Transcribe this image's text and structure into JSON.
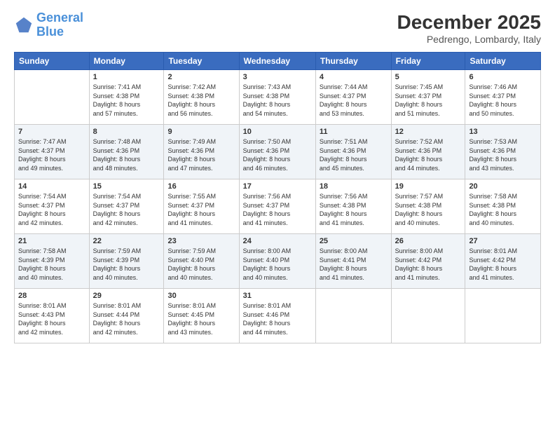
{
  "header": {
    "logo_line1": "General",
    "logo_line2": "Blue",
    "month_title": "December 2025",
    "location": "Pedrengo, Lombardy, Italy"
  },
  "days_of_week": [
    "Sunday",
    "Monday",
    "Tuesday",
    "Wednesday",
    "Thursday",
    "Friday",
    "Saturday"
  ],
  "weeks": [
    [
      {
        "num": "",
        "info": ""
      },
      {
        "num": "1",
        "info": "Sunrise: 7:41 AM\nSunset: 4:38 PM\nDaylight: 8 hours\nand 57 minutes."
      },
      {
        "num": "2",
        "info": "Sunrise: 7:42 AM\nSunset: 4:38 PM\nDaylight: 8 hours\nand 56 minutes."
      },
      {
        "num": "3",
        "info": "Sunrise: 7:43 AM\nSunset: 4:38 PM\nDaylight: 8 hours\nand 54 minutes."
      },
      {
        "num": "4",
        "info": "Sunrise: 7:44 AM\nSunset: 4:37 PM\nDaylight: 8 hours\nand 53 minutes."
      },
      {
        "num": "5",
        "info": "Sunrise: 7:45 AM\nSunset: 4:37 PM\nDaylight: 8 hours\nand 51 minutes."
      },
      {
        "num": "6",
        "info": "Sunrise: 7:46 AM\nSunset: 4:37 PM\nDaylight: 8 hours\nand 50 minutes."
      }
    ],
    [
      {
        "num": "7",
        "info": "Sunrise: 7:47 AM\nSunset: 4:37 PM\nDaylight: 8 hours\nand 49 minutes."
      },
      {
        "num": "8",
        "info": "Sunrise: 7:48 AM\nSunset: 4:36 PM\nDaylight: 8 hours\nand 48 minutes."
      },
      {
        "num": "9",
        "info": "Sunrise: 7:49 AM\nSunset: 4:36 PM\nDaylight: 8 hours\nand 47 minutes."
      },
      {
        "num": "10",
        "info": "Sunrise: 7:50 AM\nSunset: 4:36 PM\nDaylight: 8 hours\nand 46 minutes."
      },
      {
        "num": "11",
        "info": "Sunrise: 7:51 AM\nSunset: 4:36 PM\nDaylight: 8 hours\nand 45 minutes."
      },
      {
        "num": "12",
        "info": "Sunrise: 7:52 AM\nSunset: 4:36 PM\nDaylight: 8 hours\nand 44 minutes."
      },
      {
        "num": "13",
        "info": "Sunrise: 7:53 AM\nSunset: 4:36 PM\nDaylight: 8 hours\nand 43 minutes."
      }
    ],
    [
      {
        "num": "14",
        "info": "Sunrise: 7:54 AM\nSunset: 4:37 PM\nDaylight: 8 hours\nand 42 minutes."
      },
      {
        "num": "15",
        "info": "Sunrise: 7:54 AM\nSunset: 4:37 PM\nDaylight: 8 hours\nand 42 minutes."
      },
      {
        "num": "16",
        "info": "Sunrise: 7:55 AM\nSunset: 4:37 PM\nDaylight: 8 hours\nand 41 minutes."
      },
      {
        "num": "17",
        "info": "Sunrise: 7:56 AM\nSunset: 4:37 PM\nDaylight: 8 hours\nand 41 minutes."
      },
      {
        "num": "18",
        "info": "Sunrise: 7:56 AM\nSunset: 4:38 PM\nDaylight: 8 hours\nand 41 minutes."
      },
      {
        "num": "19",
        "info": "Sunrise: 7:57 AM\nSunset: 4:38 PM\nDaylight: 8 hours\nand 40 minutes."
      },
      {
        "num": "20",
        "info": "Sunrise: 7:58 AM\nSunset: 4:38 PM\nDaylight: 8 hours\nand 40 minutes."
      }
    ],
    [
      {
        "num": "21",
        "info": "Sunrise: 7:58 AM\nSunset: 4:39 PM\nDaylight: 8 hours\nand 40 minutes."
      },
      {
        "num": "22",
        "info": "Sunrise: 7:59 AM\nSunset: 4:39 PM\nDaylight: 8 hours\nand 40 minutes."
      },
      {
        "num": "23",
        "info": "Sunrise: 7:59 AM\nSunset: 4:40 PM\nDaylight: 8 hours\nand 40 minutes."
      },
      {
        "num": "24",
        "info": "Sunrise: 8:00 AM\nSunset: 4:40 PM\nDaylight: 8 hours\nand 40 minutes."
      },
      {
        "num": "25",
        "info": "Sunrise: 8:00 AM\nSunset: 4:41 PM\nDaylight: 8 hours\nand 41 minutes."
      },
      {
        "num": "26",
        "info": "Sunrise: 8:00 AM\nSunset: 4:42 PM\nDaylight: 8 hours\nand 41 minutes."
      },
      {
        "num": "27",
        "info": "Sunrise: 8:01 AM\nSunset: 4:42 PM\nDaylight: 8 hours\nand 41 minutes."
      }
    ],
    [
      {
        "num": "28",
        "info": "Sunrise: 8:01 AM\nSunset: 4:43 PM\nDaylight: 8 hours\nand 42 minutes."
      },
      {
        "num": "29",
        "info": "Sunrise: 8:01 AM\nSunset: 4:44 PM\nDaylight: 8 hours\nand 42 minutes."
      },
      {
        "num": "30",
        "info": "Sunrise: 8:01 AM\nSunset: 4:45 PM\nDaylight: 8 hours\nand 43 minutes."
      },
      {
        "num": "31",
        "info": "Sunrise: 8:01 AM\nSunset: 4:46 PM\nDaylight: 8 hours\nand 44 minutes."
      },
      {
        "num": "",
        "info": ""
      },
      {
        "num": "",
        "info": ""
      },
      {
        "num": "",
        "info": ""
      }
    ]
  ]
}
